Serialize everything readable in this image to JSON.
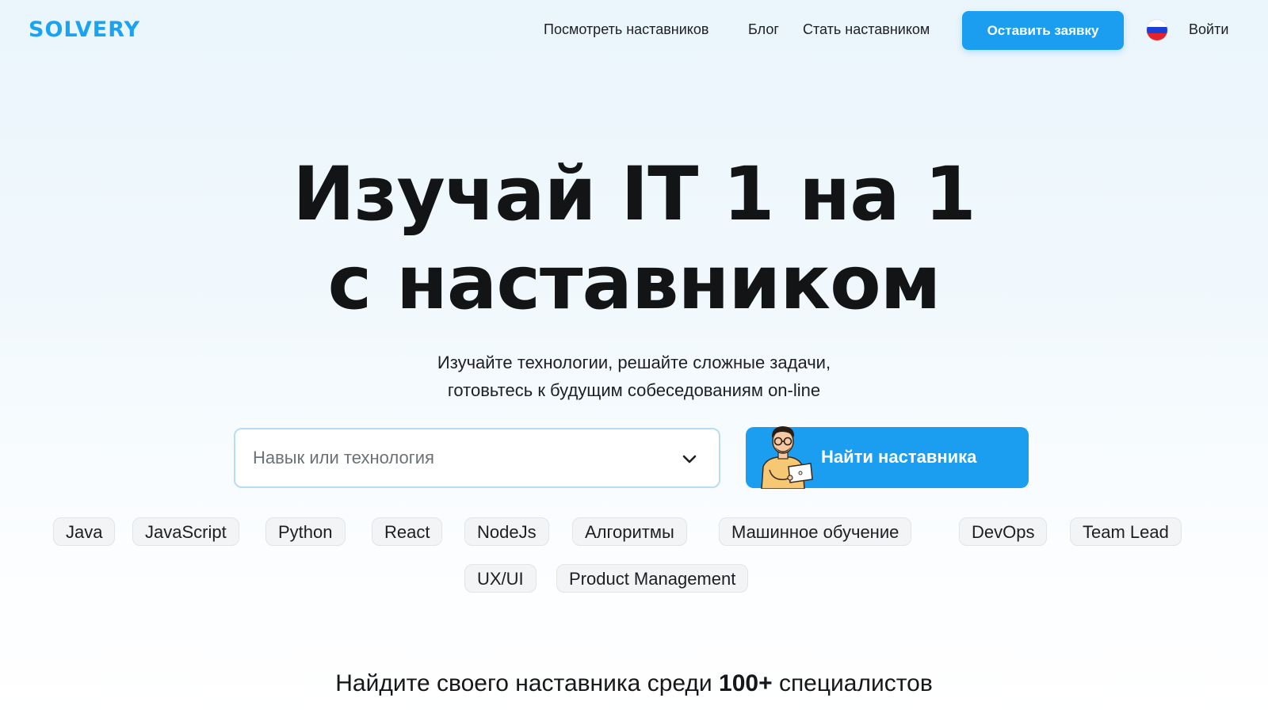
{
  "header": {
    "logo": "SOLVERY",
    "nav": {
      "mentors": "Посмотреть наставников",
      "blog": "Блог",
      "become": "Стать наставником"
    },
    "cta": "Оставить заявку",
    "language_flag": "russia-flag-icon",
    "login": "Войти"
  },
  "hero": {
    "title_line1": "Изучай IT 1 на 1",
    "title_line2": "с наставником",
    "subtitle_line1": "Изучайте технологии, решайте сложные задачи,",
    "subtitle_line2": "готовьтесь к будущим собеседованиям on-line"
  },
  "search": {
    "placeholder": "Навык или технология",
    "button": "Найти наставника"
  },
  "tags": [
    "Java",
    "JavaScript",
    "Python",
    "React",
    "NodeJs",
    "Алгоритмы",
    "Машинное обучение",
    "DevOps",
    "Team Lead",
    "UX/UI",
    "Product Management"
  ],
  "bottom": {
    "prefix": "Найдите своего наставника среди",
    "count": "100+",
    "suffix": "специалистов"
  },
  "colors": {
    "accent": "#1b9df0",
    "logo": "#1aa3f0",
    "text": "#15171a"
  }
}
